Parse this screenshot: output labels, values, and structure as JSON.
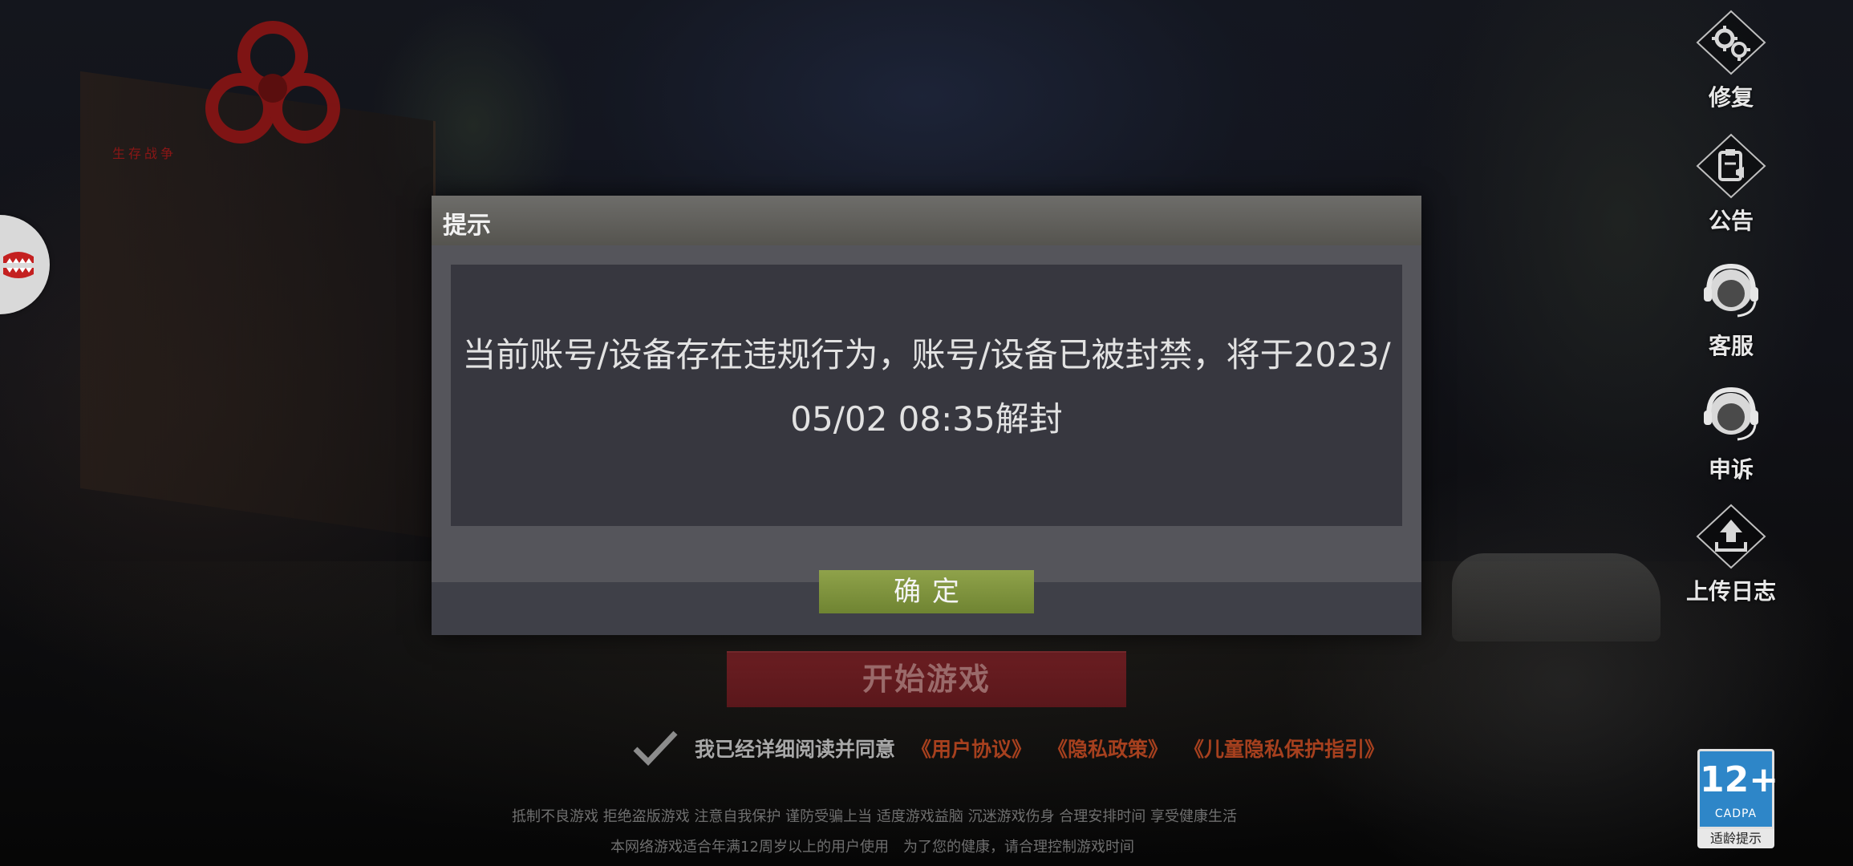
{
  "background": {
    "logo_text": "生存战争"
  },
  "left_widget": {
    "icon": "chomping-teeth-icon"
  },
  "side_menu": [
    {
      "label": "修复",
      "icon": "gears-icon"
    },
    {
      "label": "公告",
      "icon": "notice-icon"
    },
    {
      "label": "客服",
      "icon": "headset-icon"
    },
    {
      "label": "申诉",
      "icon": "headset-icon"
    },
    {
      "label": "上传日志",
      "icon": "upload-icon"
    }
  ],
  "age_badge": {
    "age": "12+",
    "org": "CADPA",
    "caption": "适龄提示",
    "color": "#2e86c8"
  },
  "start_button": {
    "label": "开始游戏"
  },
  "agreement": {
    "text": "我已经详细阅读并同意",
    "links": [
      "《用户协议》",
      "《隐私政策》",
      "《儿童隐私保护指引》"
    ]
  },
  "health_notice": {
    "line1": "抵制不良游戏 拒绝盗版游戏 注意自我保护 谨防受骗上当 适度游戏益脑 沉迷游戏伤身 合理安排时间 享受健康生活",
    "line2": "本网络游戏适合年满12周岁以上的用户使用　为了您的健康，请合理控制游戏时间"
  },
  "dialog": {
    "title": "提示",
    "message": "当前账号/设备存在违规行为，账号/设备已被封禁，将于2023/05/02 08:35解封",
    "confirm_label": "确定"
  }
}
